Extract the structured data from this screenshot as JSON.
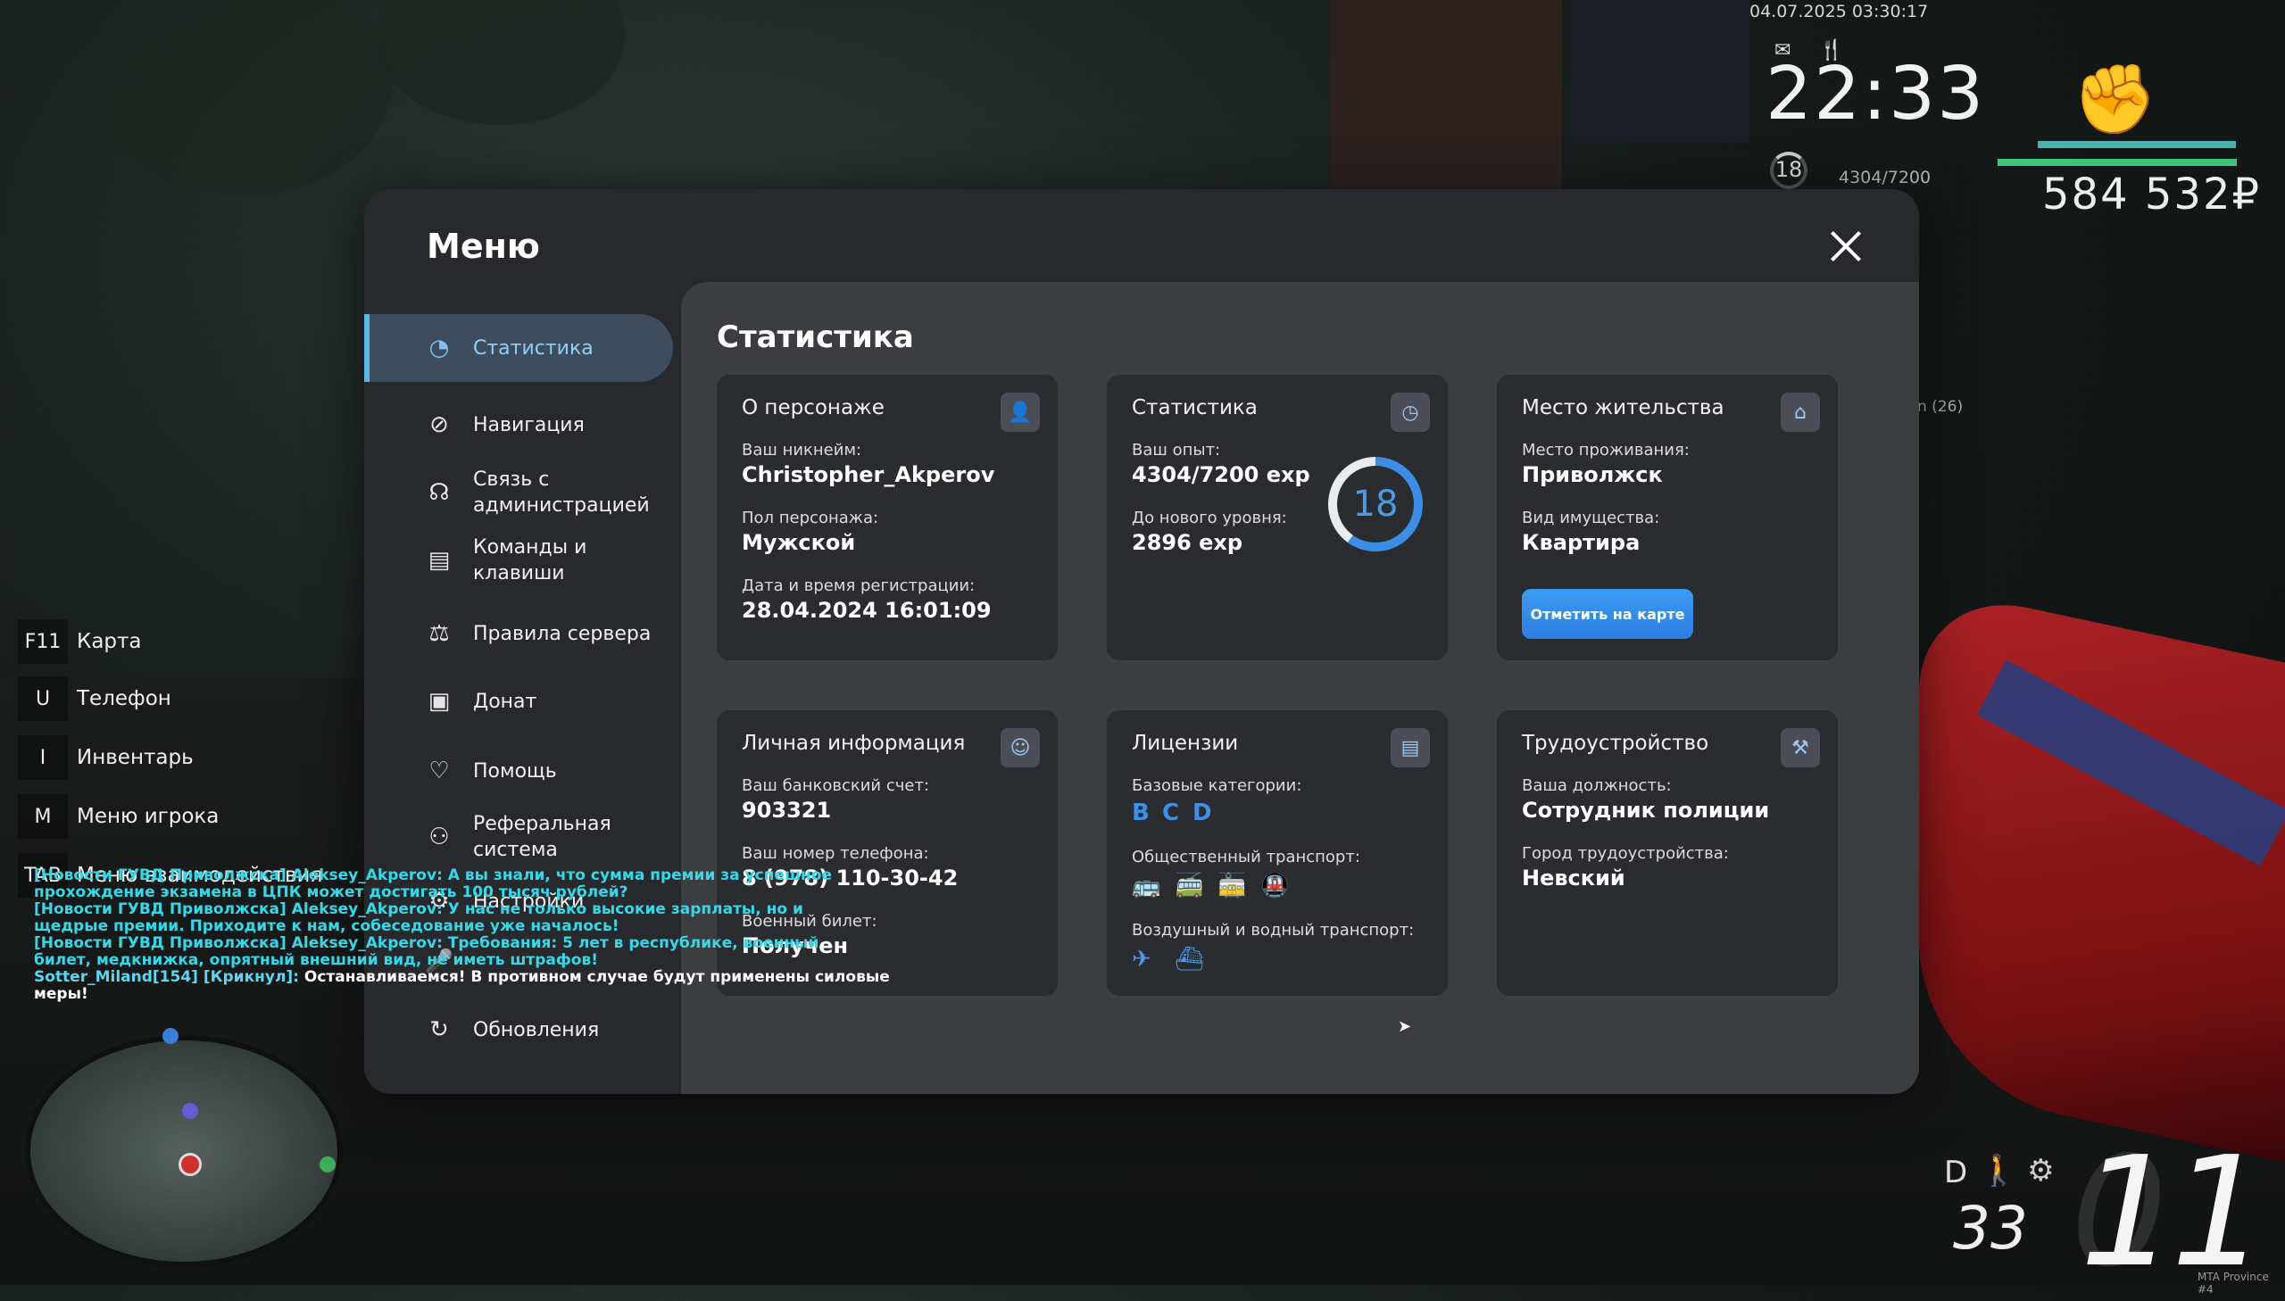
{
  "hud": {
    "datetime": "04.07.2025 03:30:17",
    "clock": "22:33",
    "level": "18",
    "exp": "4304/7200",
    "money": "584 532₽",
    "side_text": "n (26)",
    "speed": "11",
    "gear": "D",
    "fuel": "33",
    "server_tag": "MTA Province #4"
  },
  "keybinds": [
    {
      "key": "F11",
      "label": "Карта"
    },
    {
      "key": "U",
      "label": "Телефон"
    },
    {
      "key": "I",
      "label": "Инвентарь"
    },
    {
      "key": "M",
      "label": "Меню игрока"
    },
    {
      "key": "TAB",
      "label": "Меню взаимодействия"
    }
  ],
  "chat": [
    {
      "text": "[Новости ГУВД Приволжска] Aleksey_Akperov: А вы знали, что сумма премии за успешное прохождение экзамена в ЦПК может достигать 100 тысяч рублей?",
      "color": "#32d9e9"
    },
    {
      "text": "[Новости ГУВД Приволжска] Aleksey_Akperov: У нас не только высокие зарплаты, но и щедрые премии. Приходите к нам, собеседование уже началось!",
      "color": "#32d9e9"
    },
    {
      "text": "[Новости ГУВД Приволжска] Aleksey_Akperov: Требования: 5 лет в республике, военный билет, медкнижка, опрятный внешний вид, не иметь штрафов!",
      "color": "#32d9e9"
    },
    {
      "text": "Sotter_Miland[154] [Крикнул]:",
      "color": "#5ad7f0",
      "rest": "Останавливаемся! В противном случае будут применены силовые меры!"
    }
  ],
  "menu": {
    "title": "Меню",
    "nav": [
      {
        "label": "Статистика",
        "icon": "pie-chart-icon",
        "glyph": "◔",
        "active": true
      },
      {
        "label": "Навигация",
        "icon": "compass-icon",
        "glyph": "⊘"
      },
      {
        "label": "Связь с администрацией",
        "icon": "headset-icon",
        "glyph": "☊"
      },
      {
        "label": "Команды и клавиши",
        "icon": "document-icon",
        "glyph": "▤"
      },
      {
        "label": "Правила сервера",
        "icon": "scales-icon",
        "glyph": "⚖"
      },
      {
        "label": "Донат",
        "icon": "wallet-icon",
        "glyph": "▣"
      },
      {
        "label": "Помощь",
        "icon": "heart-hands-icon",
        "glyph": "♡"
      },
      {
        "label": "Реферальная система",
        "icon": "referral-icon",
        "glyph": "⚇"
      },
      {
        "label": "Настройки",
        "icon": "gear-icon",
        "glyph": "⚙"
      },
      {
        "label": "",
        "icon": "microphone-icon",
        "glyph": "🎤"
      },
      {
        "label": "Обновления",
        "icon": "refresh-icon",
        "glyph": "↻"
      }
    ],
    "section_title": "Статистика",
    "cards": {
      "character": {
        "title": "О персонаже",
        "nickname_label": "Ваш никнейм:",
        "nickname": "Christopher_Akperov",
        "gender_label": "Пол персонажа:",
        "gender": "Мужской",
        "reg_label": "Дата и время регистрации:",
        "reg": "28.04.2024 16:01:09"
      },
      "stats": {
        "title": "Статистика",
        "exp_label": "Ваш опыт:",
        "exp": "4304/7200 exp",
        "next_label": "До нового уровня:",
        "next": "2896 exp",
        "level": "18",
        "progress": 0.6
      },
      "residence": {
        "title": "Место жительства",
        "place_label": "Место проживания:",
        "place": "Приволжск",
        "property_label": "Вид имущества:",
        "property": "Квартира",
        "button": "Отметить на карте"
      },
      "personal": {
        "title": "Личная информация",
        "bank_label": "Ваш банковский счет:",
        "bank": "903321",
        "phone_label": "Ваш номер телефона:",
        "phone": "8 (978) 110-30-42",
        "military_label": "Военный билет:",
        "military": "Получен"
      },
      "licenses": {
        "title": "Лицензии",
        "base_label": "Базовые категории:",
        "categories": [
          "B",
          "C",
          "D"
        ],
        "public_label": "Общественный транспорт:",
        "public_icons": [
          "bus-icon",
          "trolleybus-icon",
          "tram-icon",
          "metro-icon"
        ],
        "air_label": "Воздушный и водный транспорт:",
        "air_icons": [
          "plane-icon",
          "ship-icon"
        ]
      },
      "job": {
        "title": "Трудоустройство",
        "position_label": "Ваша должность:",
        "position": "Сотрудник полиции",
        "city_label": "Город трудоустройства:",
        "city": "Невский"
      }
    }
  },
  "colors": {
    "accent": "#3b8ee6",
    "menu_bg": "#27292d",
    "content_bg": "#3b3d41",
    "card_bg": "#2a2c30"
  }
}
